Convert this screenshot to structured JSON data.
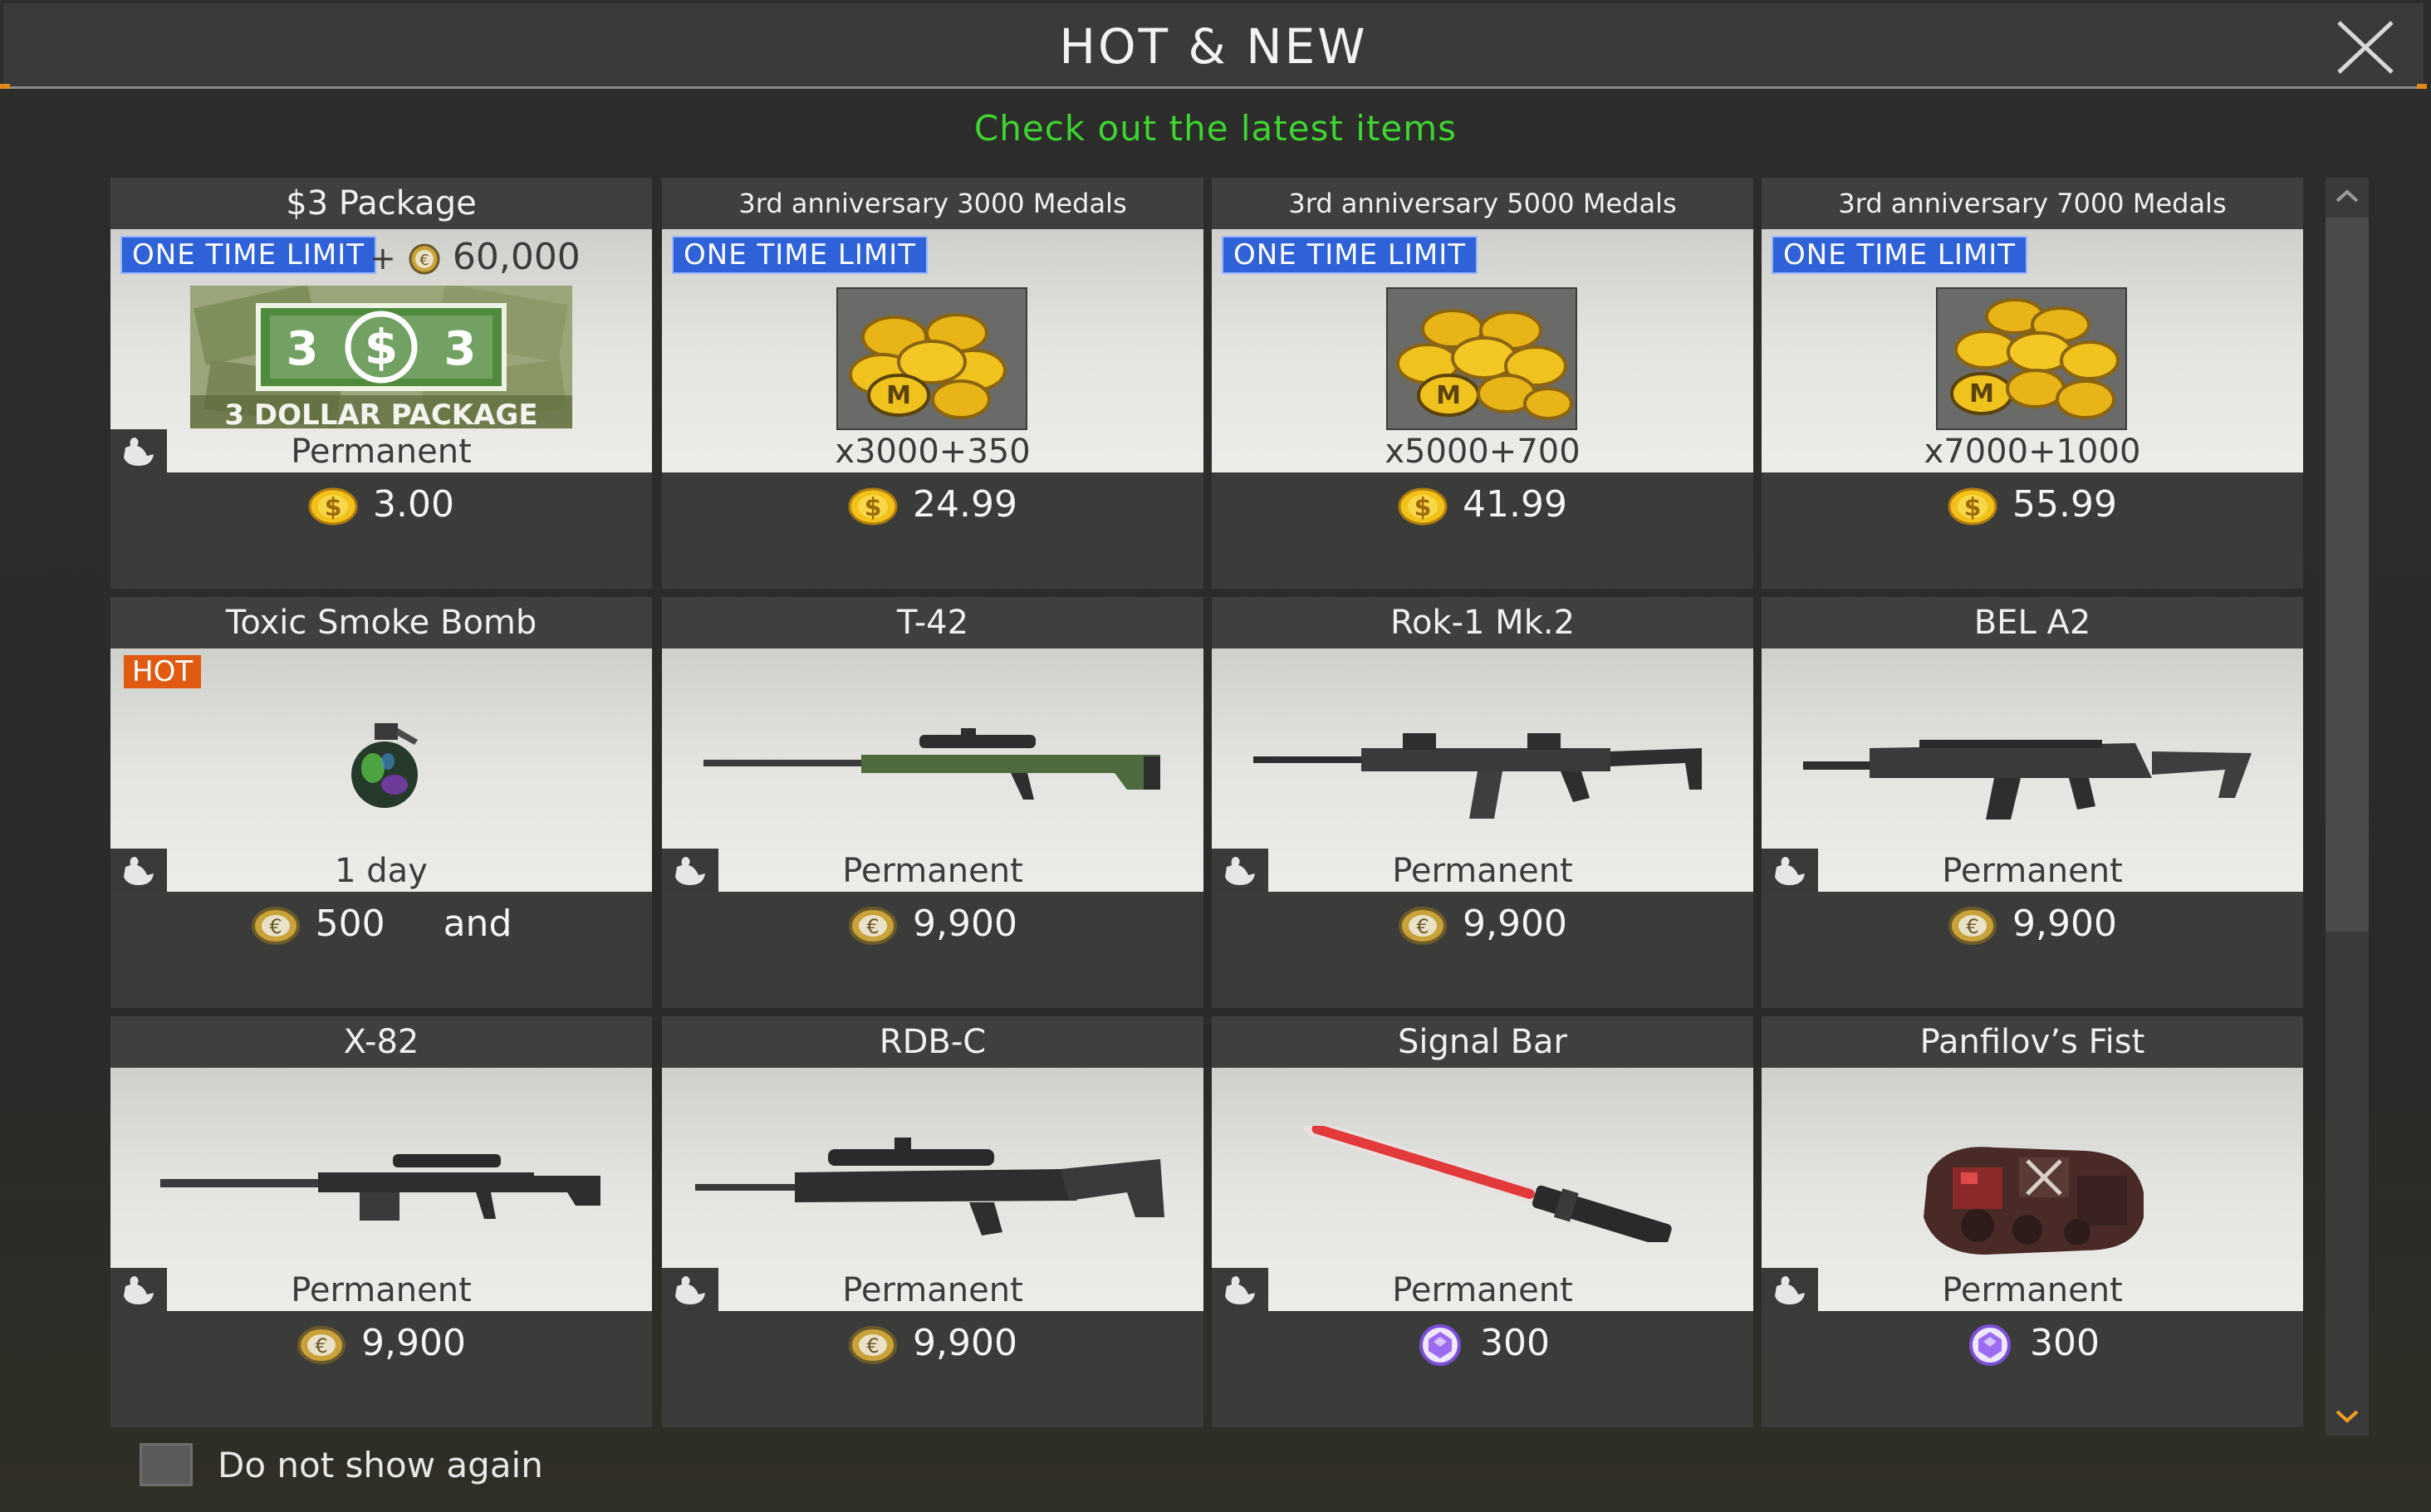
{
  "header": {
    "title": "HOT & NEW",
    "subtitle": "Check out the latest items"
  },
  "colors": {
    "accent_green": "#3ed432",
    "limit_blue": "#2f62d8",
    "hot_orange": "#e05a12",
    "coin_gold": "#f2c21a"
  },
  "items": [
    {
      "name": "$3 Package",
      "badge": "ONE TIME LIMIT",
      "bonus": "60,000",
      "banner": "3 DOLLAR PACKAGE",
      "duration": "Permanent",
      "price": "3.00",
      "currency": "dollar-coin-icon"
    },
    {
      "name": "3rd anniversary 3000 Medals",
      "badge": "ONE TIME LIMIT",
      "duration": "x3000+350",
      "price": "24.99",
      "currency": "dollar-coin-icon"
    },
    {
      "name": "3rd anniversary 5000 Medals",
      "badge": "ONE TIME LIMIT",
      "duration": "x5000+700",
      "price": "41.99",
      "currency": "dollar-coin-icon"
    },
    {
      "name": "3rd anniversary 7000 Medals",
      "badge": "ONE TIME LIMIT",
      "duration": "x7000+1000",
      "price": "55.99",
      "currency": "dollar-coin-icon"
    },
    {
      "name": "Toxic Smoke Bomb",
      "badge": "HOT",
      "duration": "1 day",
      "price": "500",
      "price_suffix": "and",
      "currency": "euro-coin-icon"
    },
    {
      "name": "T-42",
      "duration": "Permanent",
      "price": "9,900",
      "currency": "euro-coin-icon",
      "type_icon": "sniper-class-icon"
    },
    {
      "name": "Rok-1 Mk.2",
      "duration": "Permanent",
      "price": "9,900",
      "currency": "euro-coin-icon",
      "type_icon": "rifle-class-icon"
    },
    {
      "name": "BEL A2",
      "duration": "Permanent",
      "price": "9,900",
      "currency": "euro-coin-icon",
      "type_icon": "ammo-class-icon"
    },
    {
      "name": "X-82",
      "duration": "Permanent",
      "price": "9,900",
      "currency": "euro-coin-icon",
      "type_icon": "sniper-class-icon"
    },
    {
      "name": "RDB-C",
      "duration": "Permanent",
      "price": "9,900",
      "currency": "euro-coin-icon",
      "type_icon": "sniper-class-icon"
    },
    {
      "name": "Signal Bar",
      "duration": "Permanent",
      "price": "300",
      "currency": "gem-icon"
    },
    {
      "name": "Panfilov’s Fist",
      "duration": "Permanent",
      "price": "300",
      "currency": "gem-icon"
    }
  ],
  "footer": {
    "do_not_show_label": "Do not show again"
  }
}
